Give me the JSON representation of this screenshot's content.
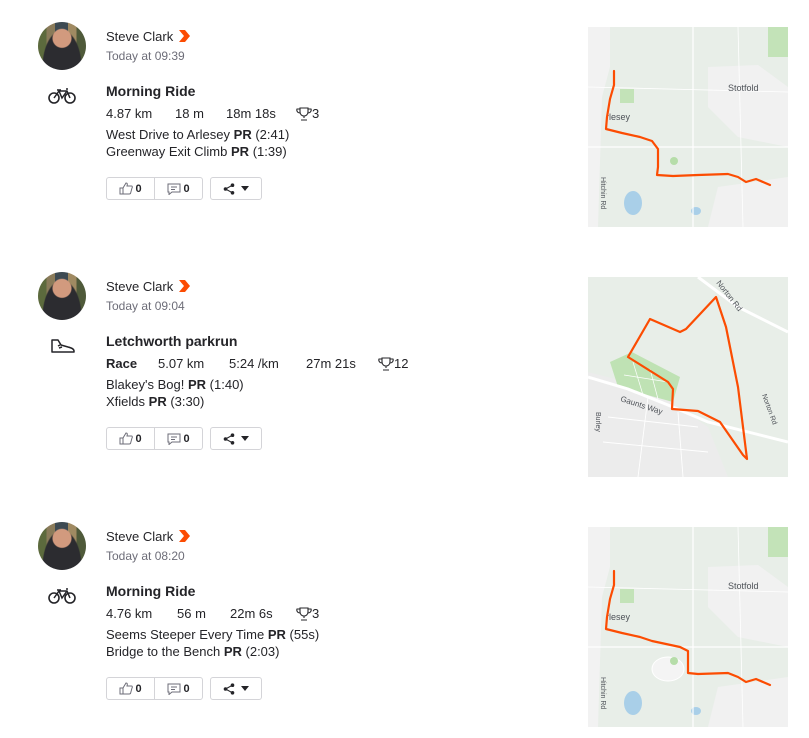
{
  "activities": [
    {
      "athlete": "Steve Clark",
      "time": "Today at 09:39",
      "sport_icon": "bike-icon",
      "title": "Morning Ride",
      "stats": [
        "4.87 km",
        "18 m",
        "18m 18s"
      ],
      "achievements": "3",
      "efforts": [
        {
          "name": "West Drive to Arlesey",
          "pr": "PR",
          "time": "(2:41)"
        },
        {
          "name": "Greenway Exit Climb",
          "pr": "PR",
          "time": "(1:39)"
        }
      ],
      "kudos": "0",
      "comments": "0",
      "map_labels": [
        "Stotfold",
        "rlesey",
        "Hitchin Rd"
      ]
    },
    {
      "athlete": "Steve Clark",
      "time": "Today at 09:04",
      "sport_icon": "shoe-icon",
      "title": "Letchworth parkrun",
      "workout_type": "Race",
      "stats": [
        "5.07 km",
        "5:24 /km",
        "27m 21s"
      ],
      "achievements": "12",
      "efforts": [
        {
          "name": "Blakey's Bog!",
          "pr": "PR",
          "time": "(1:40)"
        },
        {
          "name": "Xfields",
          "pr": "PR",
          "time": "(3:30)"
        }
      ],
      "kudos": "0",
      "comments": "0",
      "map_labels": [
        "Norton Rd",
        "Gaunts Way",
        "Burley",
        "Norton Rd"
      ]
    },
    {
      "athlete": "Steve Clark",
      "time": "Today at 08:20",
      "sport_icon": "bike-icon",
      "title": "Morning Ride",
      "stats": [
        "4.76 km",
        "56 m",
        "22m 6s"
      ],
      "achievements": "3",
      "efforts": [
        {
          "name": "Seems Steeper Every Time",
          "pr": "PR",
          "time": "(55s)"
        },
        {
          "name": "Bridge to the Bench",
          "pr": "PR",
          "time": "(2:03)"
        }
      ],
      "kudos": "0",
      "comments": "0",
      "map_labels": [
        "Stotfold",
        "rlesey",
        "Hitchin Rd"
      ]
    }
  ],
  "colors": {
    "route": "#fc4c02",
    "map_land": "#e7ede7",
    "map_park": "#bfe2b4",
    "map_water": "#a9cfe8"
  }
}
